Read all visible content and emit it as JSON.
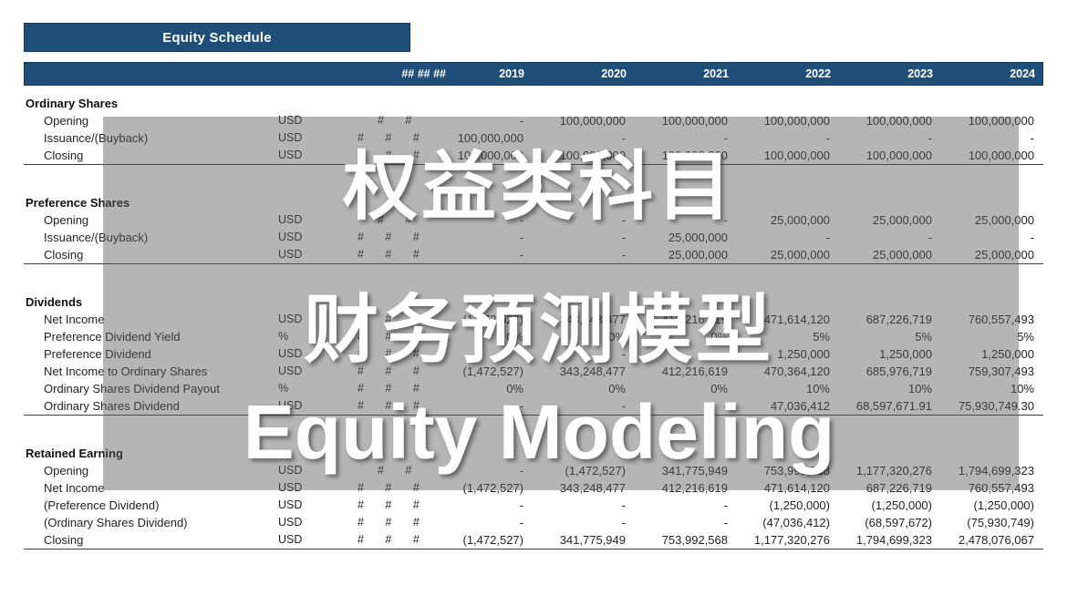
{
  "title": "Equity Schedule",
  "columns": {
    "hash_header": "## ## ##",
    "years": [
      "2019",
      "2020",
      "2021",
      "2022",
      "2023",
      "2024"
    ]
  },
  "units": {
    "usd": "USD",
    "pct": "%"
  },
  "hash_cell": "#   #   #",
  "hash_cell_short": "#   #",
  "overlay": {
    "line1": "权益类科目",
    "line2": "财务预测模型",
    "line3": "Equity Modeling"
  },
  "colors": {
    "banner": "#1f4e79",
    "banner_text": "#ffffff",
    "overlay_panel": "rgba(90,90,90,0.45)",
    "body_text": "#222222",
    "rule": "#404040"
  },
  "sections": [
    {
      "name": "Ordinary Shares",
      "rows": [
        {
          "label": "Opening",
          "unit": "USD",
          "hash": "#   #",
          "values": [
            "-",
            "100,000,000",
            "100,000,000",
            "100,000,000",
            "100,000,000",
            "100,000,000"
          ]
        },
        {
          "label": "Issuance/(Buyback)",
          "unit": "USD",
          "hash": "#   #   #",
          "values": [
            "100,000,000",
            "-",
            "-",
            "-",
            "-",
            "-"
          ]
        },
        {
          "label": "Closing",
          "unit": "USD",
          "hash": "#   #   #",
          "values": [
            "100,000,000",
            "100,000,000",
            "100,000,000",
            "100,000,000",
            "100,000,000",
            "100,000,000"
          ],
          "rule": true
        }
      ]
    },
    {
      "name": "Preference Shares",
      "rows": [
        {
          "label": "Opening",
          "unit": "USD",
          "hash": "#   #",
          "values": [
            "-",
            "-",
            "-",
            "25,000,000",
            "25,000,000",
            "25,000,000"
          ]
        },
        {
          "label": "Issuance/(Buyback)",
          "unit": "USD",
          "hash": "#   #   #",
          "values": [
            "-",
            "-",
            "25,000,000",
            "-",
            "-",
            "-"
          ]
        },
        {
          "label": "Closing",
          "unit": "USD",
          "hash": "#   #   #",
          "values": [
            "-",
            "-",
            "25,000,000",
            "25,000,000",
            "25,000,000",
            "25,000,000"
          ],
          "rule": true
        }
      ]
    },
    {
      "name": "Dividends",
      "rows": [
        {
          "label": "Net Income",
          "unit": "USD",
          "hash": "#   #   #",
          "values": [
            "(1,472,527)",
            "343,248,477",
            "412,216,619",
            "471,614,120",
            "687,226,719",
            "760,557,493"
          ]
        },
        {
          "label": "Preference Dividend Yield",
          "unit": "%",
          "hash": "#   #   #",
          "values": [
            "0%",
            "0%",
            "0%",
            "5%",
            "5%",
            "5%"
          ]
        },
        {
          "label": "Preference Dividend",
          "unit": "USD",
          "hash": "#   #   #",
          "values": [
            "-",
            "-",
            "-",
            "1,250,000",
            "1,250,000",
            "1,250,000"
          ]
        },
        {
          "label": "Net Income to Ordinary Shares",
          "unit": "USD",
          "hash": "#   #   #",
          "values": [
            "(1,472,527)",
            "343,248,477",
            "412,216,619",
            "470,364,120",
            "685,976,719",
            "759,307,493"
          ]
        },
        {
          "label": "Ordinary Shares Dividend Payout",
          "unit": "%",
          "hash": "#   #   #",
          "values": [
            "0%",
            "0%",
            "0%",
            "10%",
            "10%",
            "10%"
          ]
        },
        {
          "label": "Ordinary Shares Dividend",
          "unit": "USD",
          "hash": "#   #   #",
          "values": [
            "-",
            "-",
            "-",
            "47,036,412",
            "68,597,671.91",
            "75,930,749.30"
          ],
          "rule": true
        }
      ]
    },
    {
      "name": "Retained Earning",
      "rows": [
        {
          "label": "Opening",
          "unit": "USD",
          "hash": "#   #",
          "values": [
            "-",
            "(1,472,527)",
            "341,775,949",
            "753,992,568",
            "1,177,320,276",
            "1,794,699,323"
          ]
        },
        {
          "label": "Net Income",
          "unit": "USD",
          "hash": "#   #   #",
          "values": [
            "(1,472,527)",
            "343,248,477",
            "412,216,619",
            "471,614,120",
            "687,226,719",
            "760,557,493"
          ]
        },
        {
          "label": "(Preference Dividend)",
          "unit": "USD",
          "hash": "#   #   #",
          "values": [
            "-",
            "-",
            "-",
            "(1,250,000)",
            "(1,250,000)",
            "(1,250,000)"
          ]
        },
        {
          "label": "(Ordinary Shares Dividend)",
          "unit": "USD",
          "hash": "#   #   #",
          "values": [
            "-",
            "-",
            "-",
            "(47,036,412)",
            "(68,597,672)",
            "(75,930,749)"
          ]
        },
        {
          "label": "Closing",
          "unit": "USD",
          "hash": "#   #   #",
          "values": [
            "(1,472,527)",
            "341,775,949",
            "753,992,568",
            "1,177,320,276",
            "1,794,699,323",
            "2,478,076,067"
          ],
          "rule": true
        }
      ]
    }
  ]
}
